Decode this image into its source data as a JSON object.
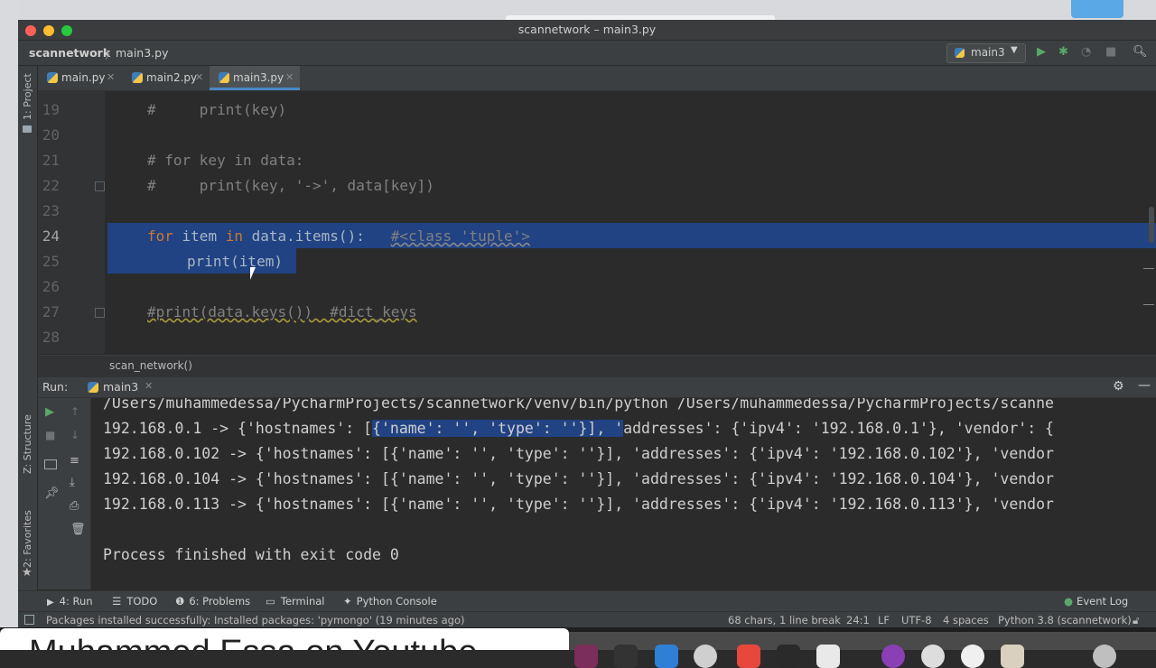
{
  "window": {
    "title": "scannetwork – main3.py"
  },
  "navbar": {
    "project": "scannetwork",
    "separator": "〉",
    "file": "main3.py",
    "run_config": "main3"
  },
  "tool_strips": {
    "project": "1: Project",
    "structure": "Z: Structure",
    "favorites": "2: Favorites"
  },
  "tabs": [
    {
      "label": "main.py",
      "active": false
    },
    {
      "label": "main2.py",
      "active": false
    },
    {
      "label": "main3.py",
      "active": true
    }
  ],
  "editor": {
    "inspections": {
      "warnings": "3",
      "checks": "1"
    },
    "lines": [
      {
        "num": "19",
        "text": "#     print(key)"
      },
      {
        "num": "20",
        "text": ""
      },
      {
        "num": "21",
        "text": "# for key in data:"
      },
      {
        "num": "22",
        "text": "#     print(key, '->', data[key])"
      },
      {
        "num": "23",
        "text": ""
      },
      {
        "num": "24",
        "kw1": "for",
        "mid1": " item ",
        "kw2": "in",
        "mid2": " data.items():   ",
        "comment": "#<class 'tuple'>"
      },
      {
        "num": "25",
        "text": "print(item)"
      },
      {
        "num": "26",
        "text": ""
      },
      {
        "num": "27",
        "text": "#print(data.keys())  #dict_keys"
      },
      {
        "num": "28",
        "text": ""
      }
    ],
    "breadcrumb": "scan_network()"
  },
  "run": {
    "label": "Run:",
    "tab": "main3",
    "lines": [
      "/Users/muhammedessa/PycharmProjects/scannetwork/venv/bin/python /Users/muhammedessa/PycharmProjects/scanne",
      "192.168.0.102 -> {'hostnames': [{'name': '', 'type': ''}], 'addresses': {'ipv4': '192.168.0.102'}, 'vendor",
      "192.168.0.104 -> {'hostnames': [{'name': '', 'type': ''}], 'addresses': {'ipv4': '192.168.0.104'}, 'vendor",
      "192.168.0.113 -> {'hostnames': [{'name': '', 'type': ''}], 'addresses': {'ipv4': '192.168.0.113'}, 'vendor",
      "",
      "Process finished with exit code 0"
    ],
    "first_line": {
      "pre": "192.168.0.1 -> {'hostnames': [",
      "selected": "{'name': '', 'type': ''}], '",
      "post": "addresses': {'ipv4': '192.168.0.1'}, 'vendor': {"
    }
  },
  "toolwindows": {
    "run": "4: Run",
    "todo": "TODO",
    "problems": "6: Problems",
    "terminal": "Terminal",
    "python_console": "Python Console",
    "event_log": "Event Log"
  },
  "status": {
    "message": "Packages installed successfully: Installed packages: 'pymongo' (19 minutes ago)",
    "selection": "68 chars, 1 line break",
    "position": "24:1",
    "line_sep": "LF",
    "encoding": "UTF-8",
    "indent": "4 spaces",
    "interpreter": "Python 3.8 (scannetwork)"
  },
  "banner": {
    "text": "Muhammed Essa on Youtube"
  },
  "colors": {
    "selection": "#214283",
    "keyword": "#cc7832",
    "comment": "#808080",
    "accent": "#4a88c7"
  }
}
